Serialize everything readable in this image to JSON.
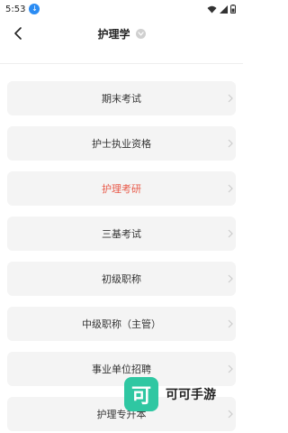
{
  "status": {
    "time": "5:53",
    "download_icon": "download-icon"
  },
  "header": {
    "title": "护理学"
  },
  "items": [
    {
      "label": "期末考试"
    },
    {
      "label": "护士执业资格"
    },
    {
      "label": "护理考研"
    },
    {
      "label": "三基考试"
    },
    {
      "label": "初级职称"
    },
    {
      "label": "中级职称（主管）"
    },
    {
      "label": "事业单位招聘"
    },
    {
      "label": "护理专升本"
    }
  ],
  "colors": {
    "active": "#e85a4a",
    "item_bg": "#f4f4f4",
    "watermark": "#2fc7a2"
  },
  "watermark": {
    "logo": "可",
    "text": "可可手游"
  }
}
